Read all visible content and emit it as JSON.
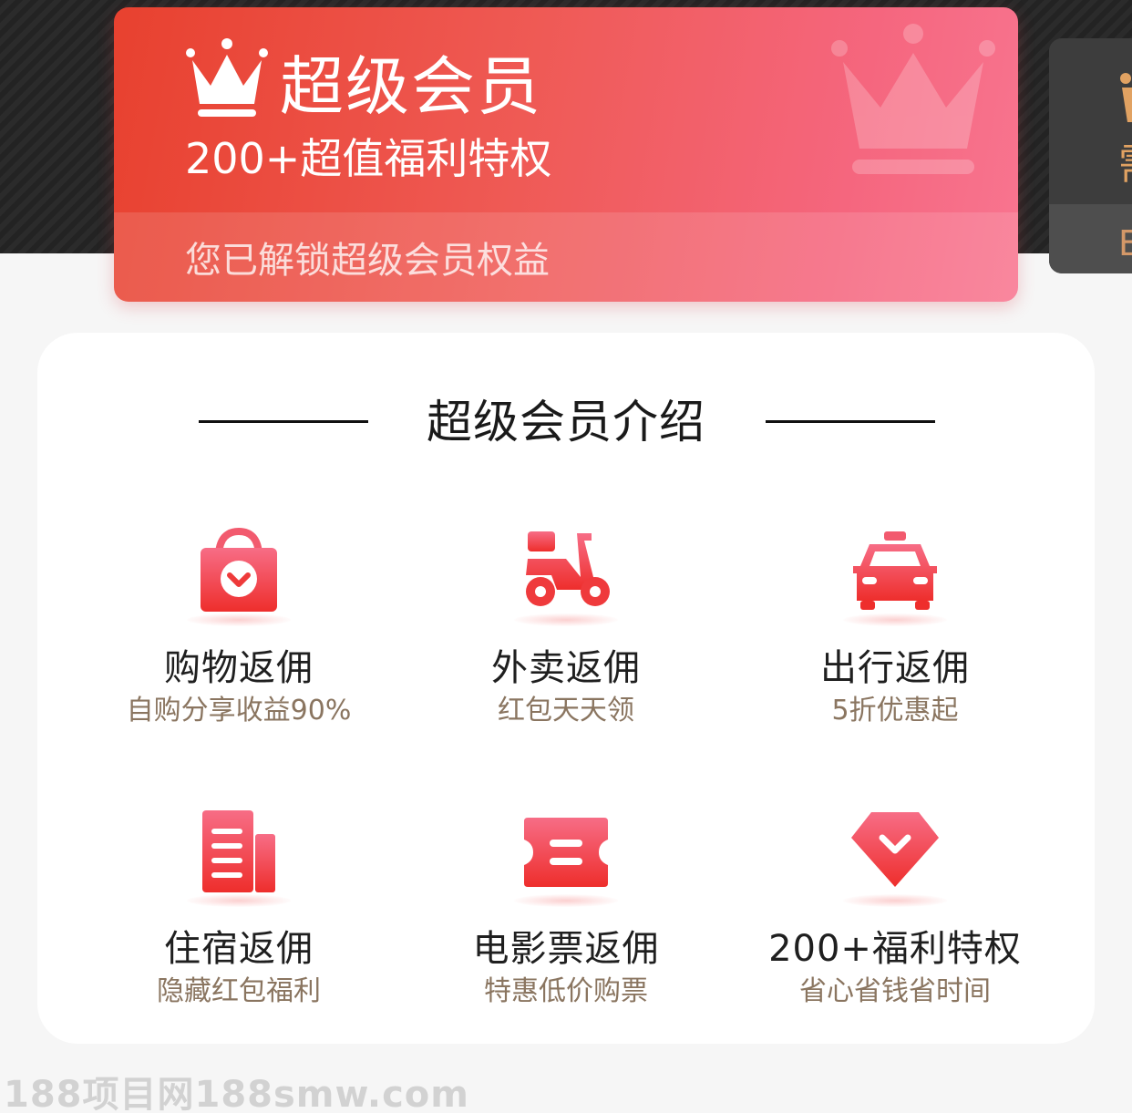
{
  "vip_card": {
    "title": "超级会员",
    "subtitle": "200+超值福利特权",
    "unlock_text": "您已解锁超级会员权益"
  },
  "side_card": {
    "glyph_top": "需",
    "glyph_bottom": "E"
  },
  "intro": {
    "title": "超级会员介绍",
    "features": [
      {
        "name": "购物返佣",
        "desc": "自购分享收益90%",
        "icon": "shopping-bag-icon"
      },
      {
        "name": "外卖返佣",
        "desc": "红包天天领",
        "icon": "scooter-icon"
      },
      {
        "name": "出行返佣",
        "desc": "5折优惠起",
        "icon": "taxi-icon"
      },
      {
        "name": "住宿返佣",
        "desc": "隐藏红包福利",
        "icon": "hotel-building-icon"
      },
      {
        "name": "电影票返佣",
        "desc": "特惠低价购票",
        "icon": "movie-ticket-icon"
      },
      {
        "name": "200+福利特权",
        "desc": "省心省钱省时间",
        "icon": "diamond-icon"
      }
    ]
  },
  "watermark": "188项目网188smw.com",
  "colors": {
    "card_start": "#e8412f",
    "card_end": "#f87590",
    "icon_red": "#f0403a",
    "desc_text": "#8a7560",
    "gold": "#e1a262"
  }
}
